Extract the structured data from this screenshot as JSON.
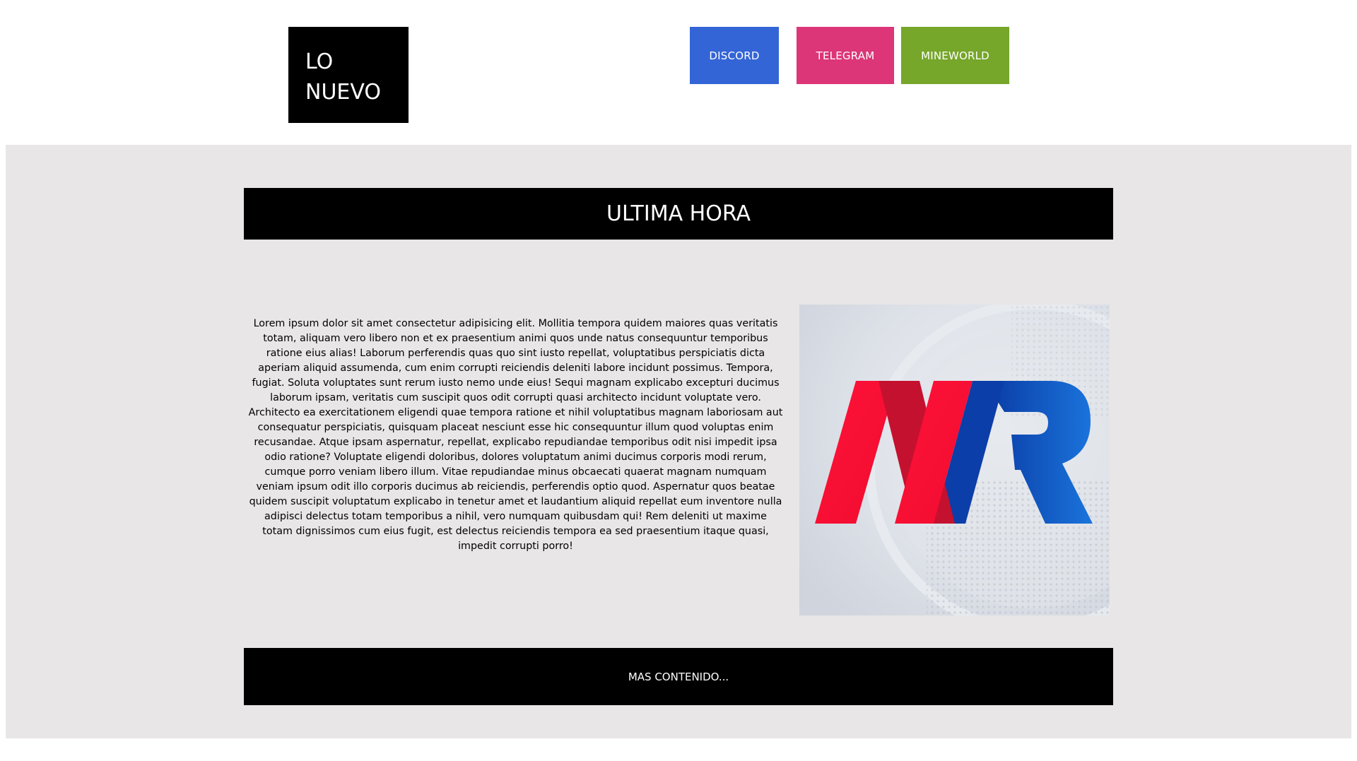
{
  "header": {
    "brand_line1": "LO",
    "brand_line2": "NUEVO",
    "nav": [
      {
        "label": "DISCORD",
        "color": "#3465d6"
      },
      {
        "label": "TELEGRAM",
        "color": "#dc3578"
      },
      {
        "label": "MINEWORLD",
        "color": "#76a62a"
      }
    ]
  },
  "main": {
    "background": "#e8e6e7",
    "headline": "ULTIMA HORA",
    "article": "Lorem ipsum dolor sit amet consectetur adipisicing elit. Mollitia tempora quidem maiores quas veritatis totam, aliquam vero libero non et ex praesentium animi quos unde natus consequuntur temporibus ratione eius alias! Laborum perferendis quas quo sint iusto repellat, voluptatibus perspiciatis dicta aperiam aliquid assumenda, cum enim corrupti reiciendis deleniti labore incidunt possimus. Tempora, fugiat. Soluta voluptates sunt rerum iusto nemo unde eius! Sequi magnam explicabo excepturi ducimus laborum ipsam, veritatis cum suscipit quos odit corrupti quasi architecto incidunt voluptate vero. Architecto ea exercitationem eligendi quae tempora ratione et nihil voluptatibus magnam laboriosam aut consequatur perspiciatis, quisquam placeat nesciunt esse hic consequuntur illum quod voluptas enim recusandae. Atque ipsam aspernatur, repellat, explicabo repudiandae temporibus odit nisi impedit ipsa odio ratione? Voluptate eligendi doloribus, dolores voluptatum animi ducimus corporis modi rerum, cumque porro veniam libero illum. Vitae repudiandae minus obcaecati quaerat magnam numquam veniam ipsum odit illo corporis ducimus ab reiciendis, perferendis optio quod. Aspernatur quos beatae quidem suscipit voluptatum explicabo in tenetur amet et laudantium aliquid repellat eum inventore nulla adipisci delectus totam temporibus a nihil, vero numquam quibusdam qui! Rem deleniti ut maxime totam dignissimos cum eius fugit, est delectus reiciendis tempora ea sed praesentium itaque quasi, impedit corrupti porro!",
    "more_label": "MAS CONTENIDO...",
    "logo_colors": {
      "red": "#ff0f37",
      "red_dark": "#c4102f",
      "blue": "#0a3da8",
      "blue_light": "#1a6fd8"
    }
  }
}
